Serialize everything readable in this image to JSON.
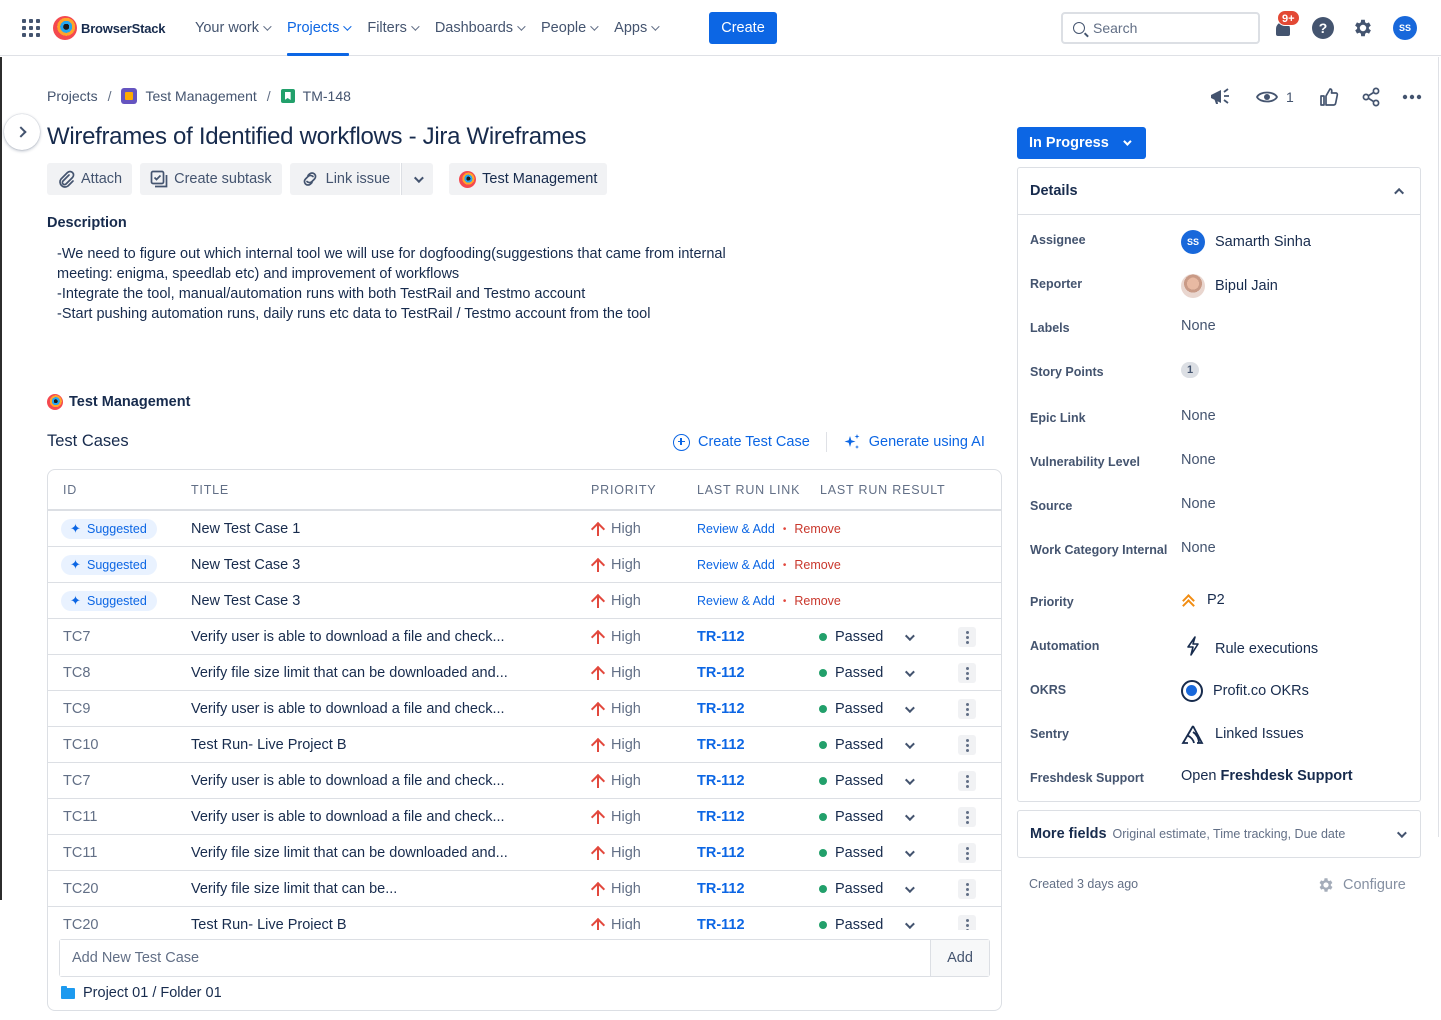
{
  "topnav": {
    "brand": "BrowserStack",
    "items": [
      {
        "label": "Your work",
        "active": false
      },
      {
        "label": "Projects",
        "active": true
      },
      {
        "label": "Filters",
        "active": false
      },
      {
        "label": "Dashboards",
        "active": false
      },
      {
        "label": "People",
        "active": false
      },
      {
        "label": "Apps",
        "active": false
      }
    ],
    "create_label": "Create",
    "search_placeholder": "Search",
    "notifications_badge": "9+",
    "help_glyph": "?",
    "avatar_initials": "SS",
    "accent_color": "#0c66e4"
  },
  "breadcrumb": {
    "root": "Projects",
    "project": "Test Management",
    "issue_key": "TM-148",
    "separator": "/"
  },
  "issue": {
    "title": "Wireframes of Identified workflows - Jira Wireframes",
    "watchers_count": "1",
    "actions": {
      "attach": "Attach",
      "create_subtask": "Create subtask",
      "link_issue": "Link issue",
      "app": "Test Management"
    },
    "description_label": "Description",
    "description_lines": [
      "-We need to figure out which internal tool we will use for dogfooding(suggestions that came from internal",
      "meeting: enigma, speedlab etc) and improvement of workflows",
      "-Integrate the tool, manual/automation runs with both TestRail and Testmo account",
      "-Start pushing automation runs, daily runs etc data to TestRail / Testmo account from the tool"
    ]
  },
  "test_management": {
    "app_title": "Test Management",
    "section_title": "Test Cases",
    "create_test_case": "Create Test Case",
    "generate_ai": "Generate using AI",
    "columns": {
      "id": "ID",
      "title": "TITLE",
      "priority": "PRIORITY",
      "last_run_link": "LAST RUN LINK",
      "last_run_result": "LAST RUN RESULT"
    },
    "suggested_rows": [
      {
        "badge": "Suggested",
        "title": "New Test Case 1",
        "priority": "High",
        "review": "Review & Add",
        "sep": "•",
        "remove": "Remove"
      },
      {
        "badge": "Suggested",
        "title": "New Test Case 3",
        "priority": "High",
        "review": "Review & Add",
        "sep": "•",
        "remove": "Remove"
      },
      {
        "badge": "Suggested",
        "title": "New Test Case 3",
        "priority": "High",
        "review": "Review & Add",
        "sep": "•",
        "remove": "Remove"
      }
    ],
    "rows": [
      {
        "id": "TC7",
        "title": "Verify user is able to download a file and check...",
        "priority": "High",
        "link": "TR-112",
        "result": "Passed"
      },
      {
        "id": "TC8",
        "title": "Verify file size limit that can be downloaded and...",
        "priority": "High",
        "link": "TR-112",
        "result": "Passed"
      },
      {
        "id": "TC9",
        "title": "Verify user is able to download a file and check...",
        "priority": "High",
        "link": "TR-112",
        "result": "Passed"
      },
      {
        "id": "TC10",
        "title": "Test Run- Live Project B",
        "priority": "High",
        "link": "TR-112",
        "result": "Passed"
      },
      {
        "id": "TC7",
        "title": "Verify user is able to download a file and check...",
        "priority": "High",
        "link": "TR-112",
        "result": "Passed"
      },
      {
        "id": "TC11",
        "title": "Verify user is able to download a file and check...",
        "priority": "High",
        "link": "TR-112",
        "result": "Passed"
      },
      {
        "id": "TC11",
        "title": "Verify file size limit that can be downloaded and...",
        "priority": "High",
        "link": "TR-112",
        "result": "Passed"
      },
      {
        "id": "TC20",
        "title": "Verify file size limit that can be...",
        "priority": "High",
        "link": "TR-112",
        "result": "Passed"
      },
      {
        "id": "TC20",
        "title": "Test Run- Live Project B",
        "priority": "High",
        "link": "TR-112",
        "result": "Passed"
      }
    ],
    "add_placeholder": "Add New Test Case",
    "add_button": "Add",
    "folder_path": "Project 01 / Folder 01"
  },
  "sidebar": {
    "status": "In Progress",
    "details_title": "Details",
    "fields": [
      {
        "label": "Assignee",
        "value": "Samarth Sinha",
        "icon": "avatar-ss"
      },
      {
        "label": "Reporter",
        "value": "Bipul Jain",
        "icon": "avatar-photo"
      },
      {
        "label": "Labels",
        "value": "None"
      },
      {
        "label": "Story Points",
        "value": "1",
        "icon": "pill"
      },
      {
        "label": "Epic Link",
        "value": "None"
      },
      {
        "label": "Vulnerability Level",
        "value": "None"
      },
      {
        "label": "Source",
        "value": "None"
      },
      {
        "label": "Work Category Internal",
        "value": "None"
      },
      {
        "label": "Priority",
        "value": "P2",
        "icon": "priority-major-icon"
      },
      {
        "label": "Automation",
        "value": "Rule executions",
        "icon": "lightning-icon"
      },
      {
        "label": "OKRS",
        "value": "Profit.co OKRs",
        "icon": "profitco-icon"
      },
      {
        "label": "Sentry",
        "value": "Linked Issues",
        "icon": "sentry-icon"
      },
      {
        "label": "Freshdesk Support",
        "value_prefix": "Open ",
        "value": "Freshdesk Support"
      }
    ],
    "more_fields_title": "More fields",
    "more_fields_sub": "Original estimate, Time tracking, Due date",
    "created": "Created 3 days ago",
    "configure": "Configure"
  }
}
